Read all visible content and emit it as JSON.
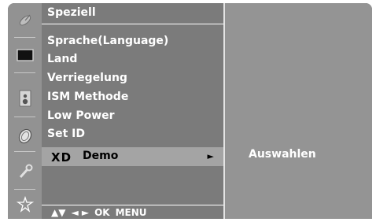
{
  "icons": [
    "satellite-dish-icon",
    "picture-icon",
    "speaker-icon",
    "clock-icon",
    "wrench-icon",
    "special-settings-icon"
  ],
  "menu": {
    "title": "Speziell",
    "items": [
      {
        "label": "Sprache(Language)"
      },
      {
        "label": "Land"
      },
      {
        "label": "Verriegelung"
      },
      {
        "label": "ISM Methode"
      },
      {
        "label": "Low Power"
      },
      {
        "label": "Set ID"
      }
    ],
    "selected": {
      "logo_text": "XD",
      "label": "Demo",
      "arrow": "►"
    },
    "nav": {
      "up_down": "▲▼",
      "left_right": "◄ ►",
      "ok": "OK",
      "menu": "MENU"
    }
  },
  "submenu": {
    "item": "Auswahlen"
  },
  "colors": {
    "panel": "#7b7b7b",
    "icon_column": "#929292",
    "right_panel": "#949494",
    "selected_row": "#a4a4a4",
    "text": "#ffffff"
  }
}
